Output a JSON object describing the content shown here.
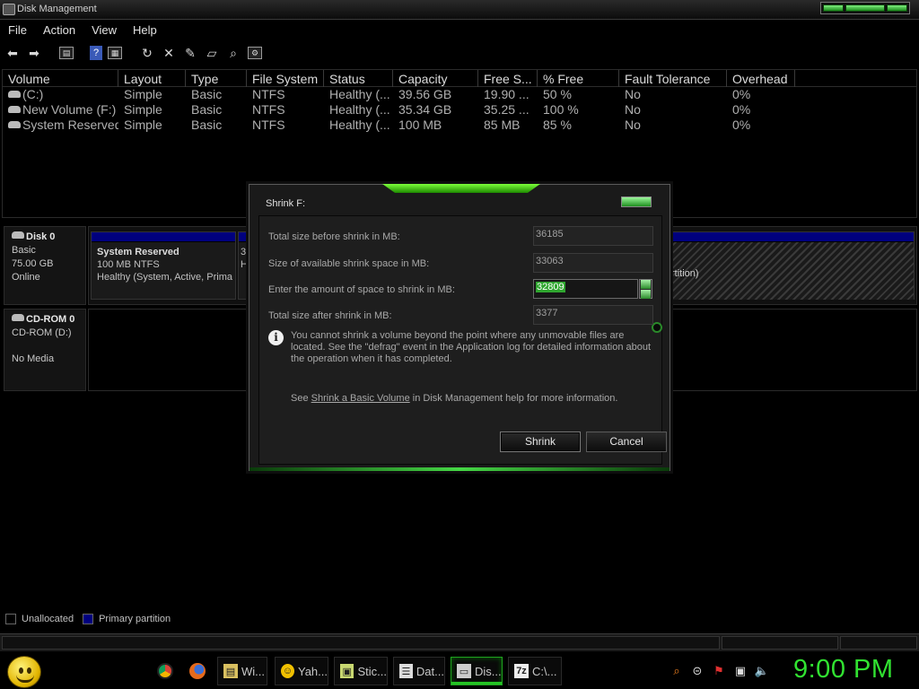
{
  "window": {
    "title": "Disk Management"
  },
  "menu": [
    "File",
    "Action",
    "View",
    "Help"
  ],
  "toolbar": {
    "icons": [
      "back-arrow-icon",
      "forward-arrow-icon",
      "show-hide-console-icon",
      "help-icon",
      "properties-icon",
      "refresh-icon",
      "delete-icon",
      "edit-icon",
      "open-folder-icon",
      "search-icon",
      "settings-icon"
    ]
  },
  "volume_list": {
    "columns": [
      "Volume",
      "Layout",
      "Type",
      "File System",
      "Status",
      "Capacity",
      "Free S...",
      "% Free",
      "Fault Tolerance",
      "Overhead"
    ],
    "rows": [
      [
        "(C:)",
        "Simple",
        "Basic",
        "NTFS",
        "Healthy (...",
        "39.56 GB",
        "19.90 ...",
        "50 %",
        "No",
        "0%"
      ],
      [
        "New Volume (F:)",
        "Simple",
        "Basic",
        "NTFS",
        "Healthy (...",
        "35.34 GB",
        "35.25 ...",
        "100 %",
        "No",
        "0%"
      ],
      [
        "System Reserved",
        "Simple",
        "Basic",
        "NTFS",
        "Healthy (...",
        "100 MB",
        "85 MB",
        "85 %",
        "No",
        "0%"
      ]
    ]
  },
  "disks": [
    {
      "name": "Disk 0",
      "type": "Basic",
      "size": "75.00 GB",
      "state": "Online",
      "partitions": [
        {
          "name": "System Reserved",
          "detail": "100 MB NTFS",
          "status": "Healthy (System, Active, Prima"
        },
        {
          "name": "",
          "detail": "3",
          "status": "H"
        },
        {
          "name": "",
          "detail": "",
          "status": "rtition)"
        }
      ]
    },
    {
      "name": "CD-ROM 0",
      "type": "CD-ROM (D:)",
      "size": "",
      "state": "No Media"
    }
  ],
  "legend": [
    "Unallocated",
    "Primary partition"
  ],
  "legend_colors": {
    "unallocated": "#000000",
    "primary": "#00007e"
  },
  "dialog": {
    "title": "Shrink F:",
    "fields": [
      {
        "label": "Total size before shrink in MB:",
        "value": "36185"
      },
      {
        "label": "Size of available shrink space in MB:",
        "value": "33063"
      },
      {
        "label": "Enter the amount of space to shrink in MB:",
        "value": "32809"
      },
      {
        "label": "Total size after shrink in MB:",
        "value": "3377"
      }
    ],
    "info": "You cannot shrink a volume beyond the point where any unmovable files are located. See the \"defrag\" event in the Application log for detailed information about the operation when it has completed.",
    "help_prefix": "See",
    "help_link": "Shrink a Basic Volume",
    "help_suffix": "in Disk Management help for more information.",
    "shrink_label": "Shrink",
    "cancel_label": "Cancel"
  },
  "taskbar": {
    "quick_launch": [
      "chrome-icon",
      "firefox-icon"
    ],
    "tasks": [
      {
        "label": "Wi...",
        "icon": "folder-icon",
        "active": false
      },
      {
        "label": "Yah...",
        "icon": "yahoo-messenger-icon",
        "active": false
      },
      {
        "label": "Stic...",
        "icon": "sticky-notes-icon",
        "active": false
      },
      {
        "label": "Dat...",
        "icon": "data-sources-icon",
        "active": false
      },
      {
        "label": "Dis...",
        "icon": "disk-management-icon",
        "active": true
      },
      {
        "label": "C:\\...",
        "icon": "7zip-icon",
        "active": false
      }
    ],
    "tray": [
      "search-icon",
      "minus-circle-icon",
      "action-center-flag-icon",
      "network-icon",
      "volume-icon"
    ],
    "clock": "9:00 PM"
  },
  "accent_color": "#31e231"
}
